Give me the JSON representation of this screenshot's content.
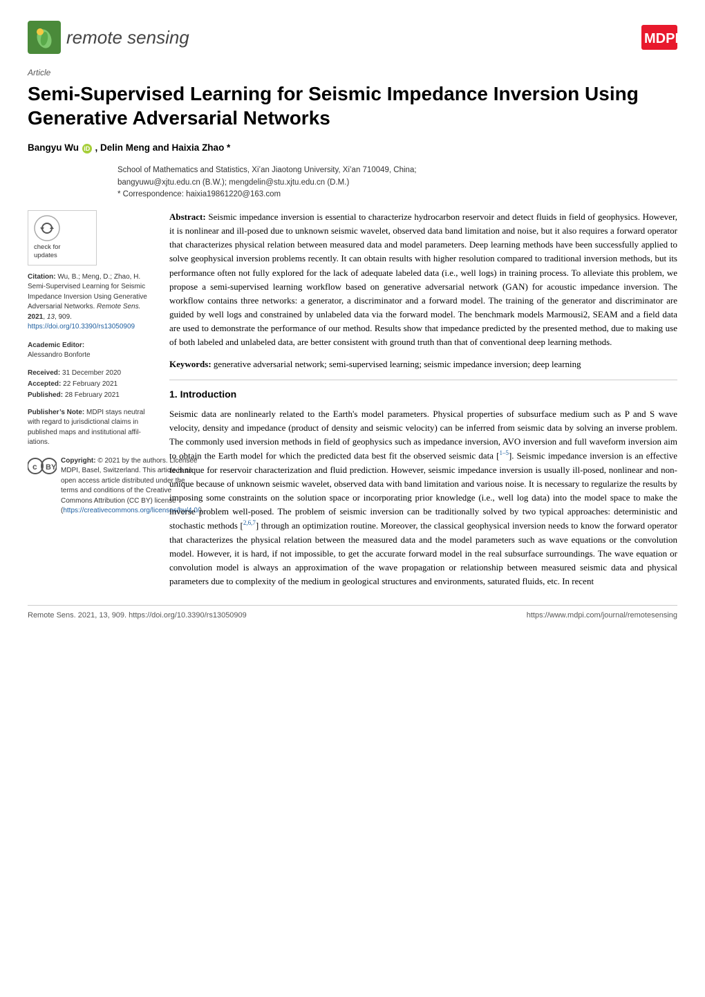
{
  "header": {
    "logo_text_italic": "remote sensing",
    "mdpi_alt": "MDPI"
  },
  "article": {
    "type_label": "Article",
    "title": "Semi-Supervised Learning for Seismic Impedance Inversion Using Generative Adversarial Networks",
    "authors": "Bangyu Wu  , Delin Meng and Haixia Zhao *",
    "affiliation_line1": "School of Mathematics and Statistics, Xi’an Jiaotong University, Xi’an 710049, China;",
    "affiliation_line2": "bangyuwu@xjtu.edu.cn (B.W.); mengdelin@stu.xjtu.edu.cn (D.M.)",
    "affiliation_line3": "* Correspondence: haixia19861220@163.com"
  },
  "check_updates": {
    "label_line1": "check for",
    "label_line2": "updates"
  },
  "citation": {
    "label": "Citation:",
    "text": "Wu, B.; Meng, D.; Zhao, H. Semi-Supervised Learning for Seismic Impedance Inversion Using Generative Adversarial Networks. Remote Sens. 2021, 13, 909. https://doi.org/10.3390/rs13050909"
  },
  "academic_editor": {
    "label": "Academic Editor:",
    "name": "Alessandro Bonforte"
  },
  "dates": {
    "received_label": "Received:",
    "received_date": "31 December 2020",
    "accepted_label": "Accepted:",
    "accepted_date": "22 February 2021",
    "published_label": "Published:",
    "published_date": "28 February 2021"
  },
  "publisher_note": {
    "label": "Publisher’s Note:",
    "text": "MDPI stays neutral with regard to jurisdictional claims in published maps and institutional affil­iations."
  },
  "copyright": {
    "label": "Copyright:",
    "text": "© 2021 by the authors. Licensee MDPI, Basel, Switzerland. This article is an open access article distributed under the terms and conditions of the Creative Commons Attribution (CC BY) license (https://creativecommons.org/licenses/by/4.0/)."
  },
  "abstract": {
    "label": "Abstract:",
    "text": "Seismic impedance inversion is essential to characterize hydrocarbon reservoir and detect fluids in field of geophysics. However, it is nonlinear and ill-posed due to unknown seismic wavelet, observed data band limitation and noise, but it also requires a forward operator that characterizes physical relation between measured data and model parameters. Deep learning methods have been successfully applied to solve geophysical inversion problems recently. It can obtain results with higher resolution compared to traditional inversion methods, but its performance often not fully explored for the lack of adequate labeled data (i.e., well logs) in training process. To alleviate this problem, we propose a semi-supervised learning workflow based on generative adversarial network (GAN) for acoustic impedance inversion. The workflow contains three networks: a generator, a discriminator and a forward model. The training of the generator and discriminator are guided by well logs and constrained by unlabeled data via the forward model. The benchmark models Marmousi2, SEAM and a field data are used to demonstrate the performance of our method. Results show that impedance predicted by the presented method, due to making use of both labeled and unlabeled data, are better consistent with ground truth than that of conventional deep learning methods."
  },
  "keywords": {
    "label": "Keywords:",
    "text": "generative adversarial network; semi-supervised learning; seismic impedance inversion; deep learning"
  },
  "introduction": {
    "heading": "1. Introduction",
    "paragraph1": "Seismic data are nonlinearly related to the Earth’s model parameters. Physical properties of subsurface medium such as P and S wave velocity, density and impedance (product of density and seismic velocity) can be inferred from seismic data by solving an inverse problem. The commonly used inversion methods in field of geophysics such as impedance inversion, AVO inversion and full waveform inversion aim to obtain the Earth model for which the predicted data best fit the observed seismic data [1–5]. Seismic impedance inversion is an effective technique for reservoir characterization and fluid prediction. However, seismic impedance inversion is usually ill-posed, nonlinear and non-unique because of unknown seismic wavelet, observed data with band limitation and various noise. It is necessary to regularize the results by imposing some constraints on the solution space or incorporating prior knowledge (i.e., well log data) into the model space to make the inverse problem well-posed. The problem of seismic inversion can be traditionally solved by two typical approaches: deterministic and stochastic methods [2,6,7] through an optimization routine. Moreover, the classical geophysical inversion needs to know the forward operator that characterizes the physical relation between the measured data and the model parameters such as wave equations or the convolution model. However, it is hard, if not impossible, to get the accurate forward model in the real subsurface surroundings. The wave equation or convolution model is always an approximation of the wave propagation or relationship between measured seismic data and physical parameters due to complexity of the medium in geological structures and environments, saturated fluids, etc. In recent"
  },
  "footer": {
    "left": "Remote Sens. 2021, 13, 909. https://doi.org/10.3390/rs13050909",
    "right": "https://www.mdpi.com/journal/remotesensing"
  }
}
